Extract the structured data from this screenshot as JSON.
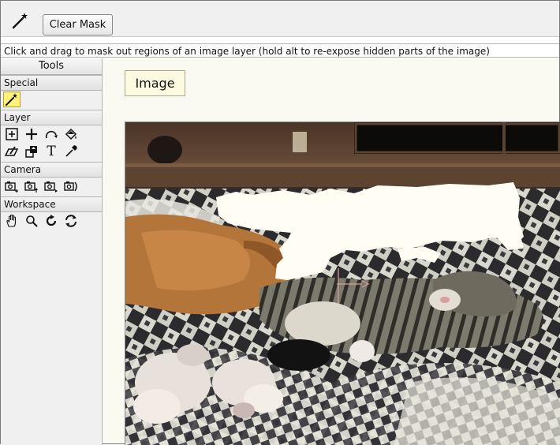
{
  "toolbar": {
    "mode_icon": "magic-wand-icon",
    "clear_mask_label": "Clear Mask"
  },
  "status": {
    "text": "Click and drag to mask out regions of an image layer (hold alt to re-expose hidden parts of the image)"
  },
  "tools_panel": {
    "title": "Tools",
    "sections": {
      "special": {
        "label": "Special",
        "tools": [
          "mask-wand-icon"
        ]
      },
      "layer": {
        "label": "Layer",
        "tools": [
          "add-layer-icon",
          "move-icon",
          "rotate-icon",
          "fill-icon",
          "edit-layer-icon",
          "duplicate-icon",
          "text-icon",
          "eyedropper-icon"
        ]
      },
      "camera": {
        "label": "Camera",
        "tools": [
          "camera-zoom-icon",
          "camera-up-icon",
          "camera-right-icon",
          "camera-rotate-icon"
        ]
      },
      "workspace": {
        "label": "Workspace",
        "tools": [
          "hand-icon",
          "zoom-icon",
          "rotate-cw-icon",
          "reset-view-icon"
        ]
      }
    },
    "text_glyphs": {
      "text_tool": "T"
    }
  },
  "canvas": {
    "layer_label": "Image"
  },
  "colors": {
    "active_tool": "#fff27a",
    "label_bg": "#fcfbe1",
    "mask": "#fffdf4"
  }
}
